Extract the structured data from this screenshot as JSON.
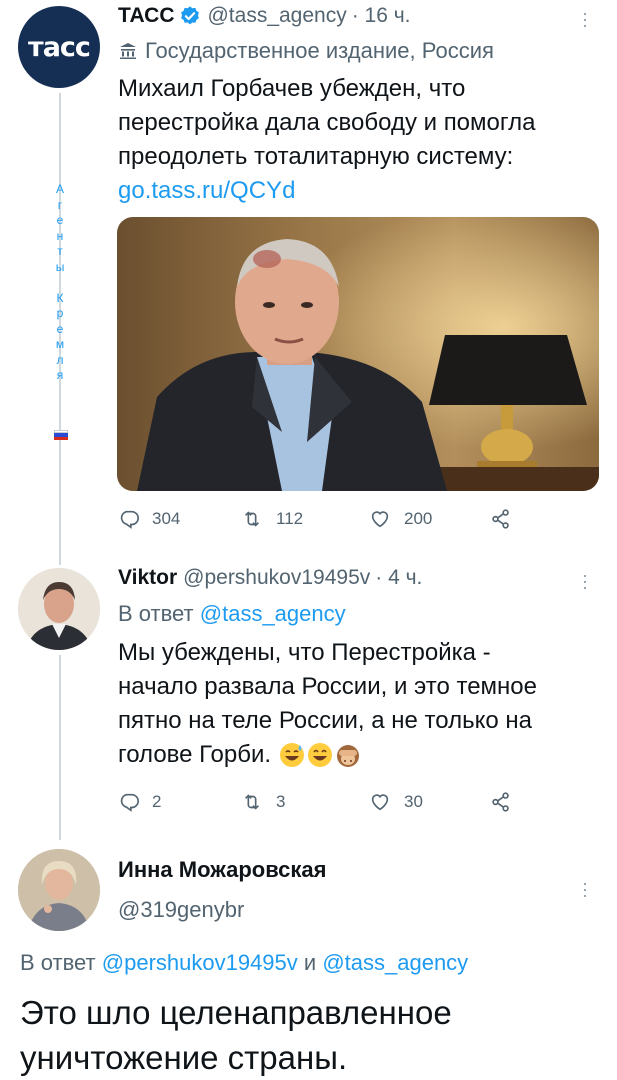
{
  "tweet1": {
    "name": "ТАСС",
    "handle": "@tass_agency",
    "time": "· 16 ч.",
    "label": "Государственное издание, Россия",
    "avatar_text": "тасс",
    "text_lines": [
      "Михаил Горбачев убежден, что",
      "перестройка дала свободу и помогла",
      "преодолеть тоталитарную систему:"
    ],
    "link": "go.tass.ru/QCYd",
    "replies": "304",
    "retweets": "112",
    "likes": "200"
  },
  "side_label": [
    "А",
    "г",
    "е",
    "н",
    "т",
    "ы",
    " ",
    "К",
    "р",
    "е",
    "м",
    "л",
    "я"
  ],
  "tweet2": {
    "name": "Viktor",
    "handle": "@pershukov19495v",
    "time": "· 4 ч.",
    "reply_prefix": "В ответ",
    "reply_to": "@tass_agency",
    "text_lines": [
      "Мы убеждены, что Перестройка -",
      "начало развала России, и это темное",
      "пятно на теле России, а не только на",
      "голове Горби."
    ],
    "emojis": [
      "sweat-smile-emoji",
      "grin-emoji",
      "see-no-evil-monkey-emoji"
    ],
    "replies": "2",
    "retweets": "3",
    "likes": "30"
  },
  "tweet3": {
    "name": "Инна Можаровская",
    "handle": "@319genybr",
    "reply_prefix": "В ответ",
    "reply_to_1": "@pershukov19495v",
    "reply_and": "и",
    "reply_to_2": "@tass_agency",
    "text_lines": [
      "Это шло целенаправленное",
      "уничтожение страны."
    ]
  },
  "colors": {
    "link": "#1d9bf0",
    "meta": "#536471",
    "tass_avatar": "#152f54"
  }
}
